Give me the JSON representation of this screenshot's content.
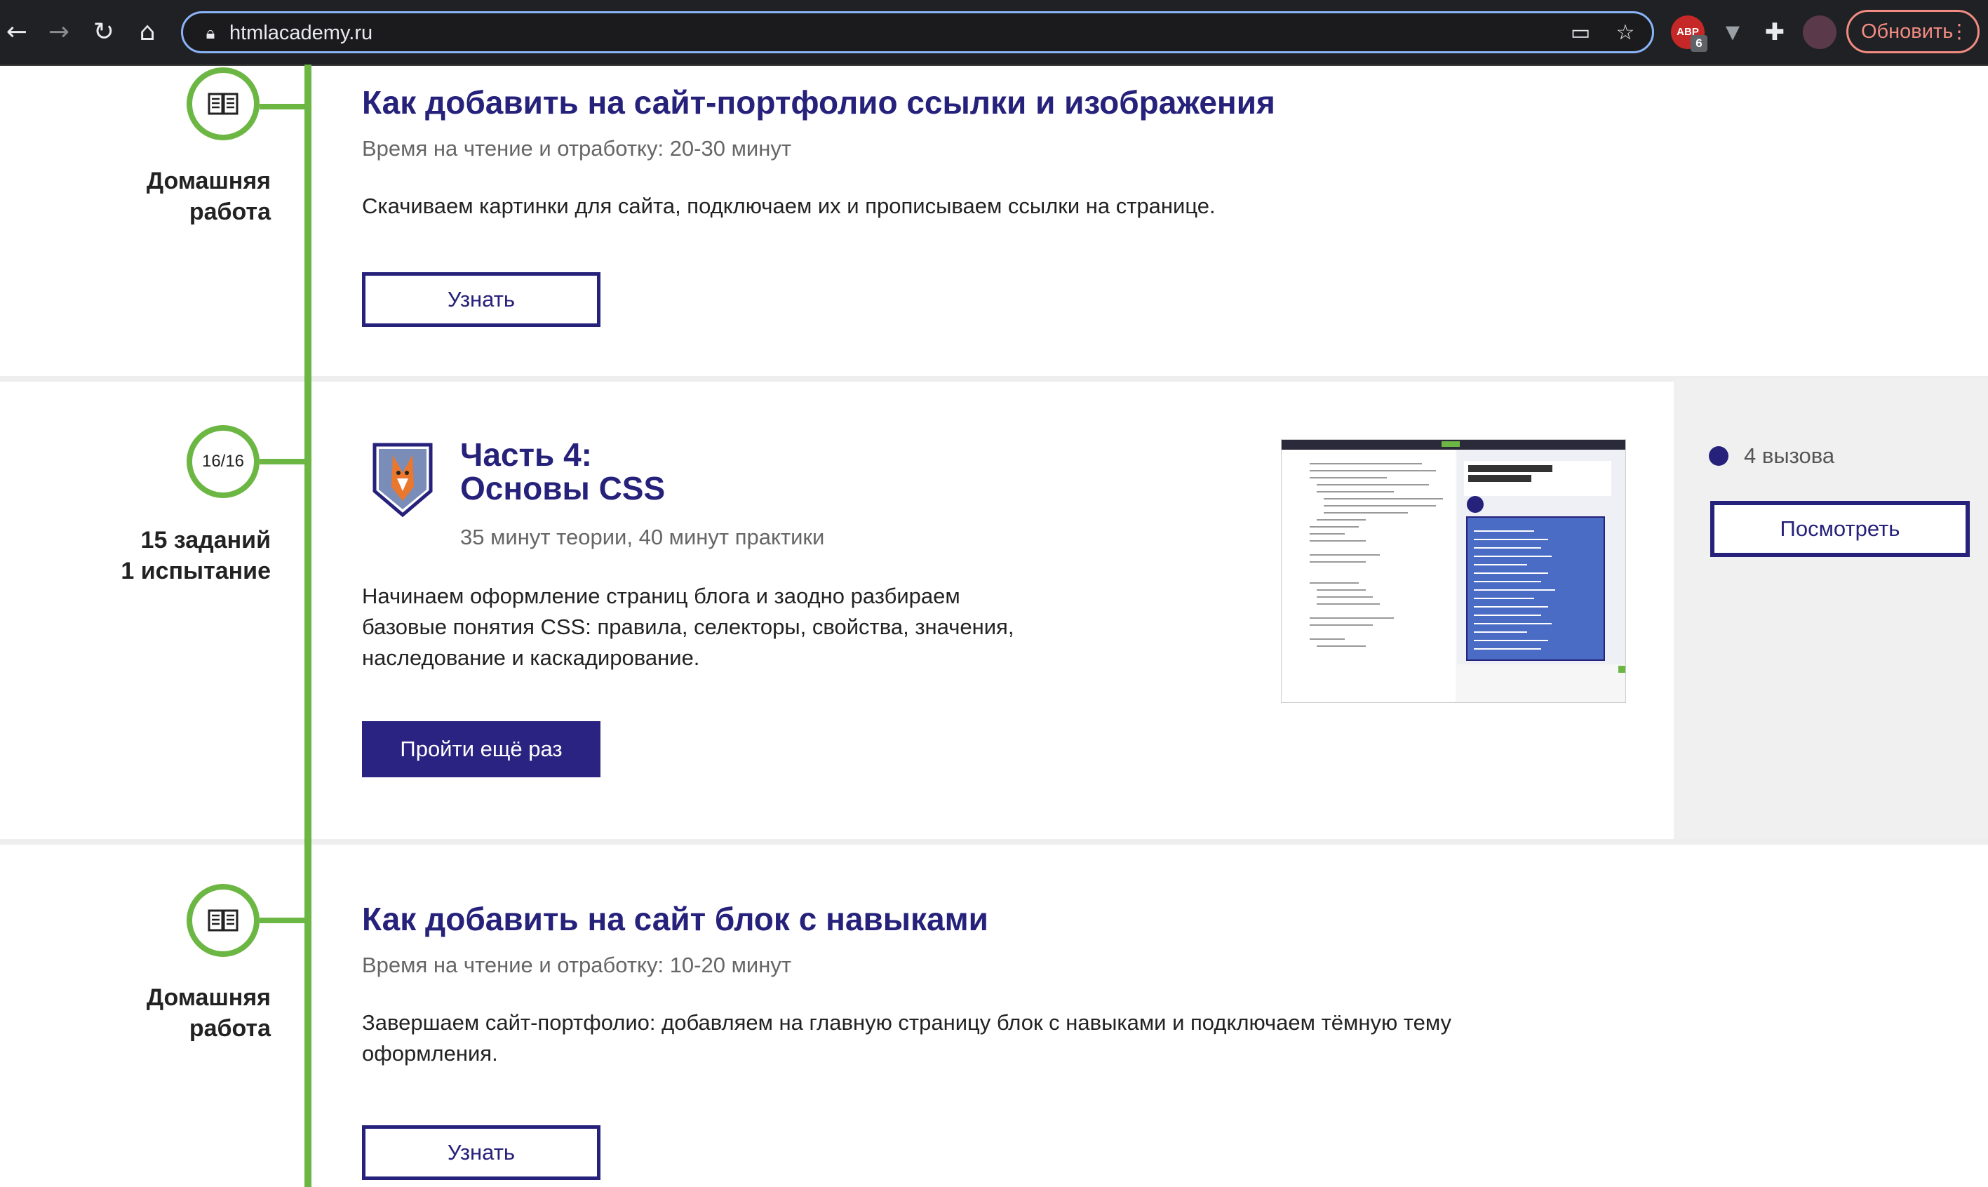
{
  "browser": {
    "url": "htmlacademy.ru",
    "update_label": "Обновить",
    "abp_label": "ABP",
    "abp_count": "6"
  },
  "items": [
    {
      "kind": "homework",
      "side_label_line1": "Домашняя",
      "side_label_line2": "работа",
      "title": "Как добавить на сайт-портфолио ссылки и изображения",
      "meta": "Время на чтение и отработку: 20-30 минут",
      "description": "Скачиваем картинки для сайта, подключаем их и прописываем ссылки на странице.",
      "button": "Узнать"
    },
    {
      "kind": "chapter",
      "progress": "16/16",
      "side_label_line1": "15 заданий",
      "side_label_line2": "1 испытание",
      "title_line1": "Часть 4:",
      "title_line2": "Основы CSS",
      "meta": "35 минут теории, 40 минут практики",
      "description_line1": "Начинаем оформление страниц блога и заодно разбираем",
      "description_line2": "базовые понятия CSS: правила, селекторы, свойства, значения,",
      "description_line3": "наследование и каскадирование.",
      "button": "Пройти ещё раз",
      "challenges": "4 вызова",
      "challenges_button": "Посмотреть"
    },
    {
      "kind": "homework",
      "side_label_line1": "Домашняя",
      "side_label_line2": "работа",
      "title": "Как добавить на сайт блок с навыками",
      "meta": "Время на чтение и отработку: 10-20 минут",
      "description_line1": "Завершаем сайт-портфолио: добавляем на главную страницу блок с навыками и подключаем тёмную тему",
      "description_line2": "оформления.",
      "button": "Узнать"
    }
  ]
}
